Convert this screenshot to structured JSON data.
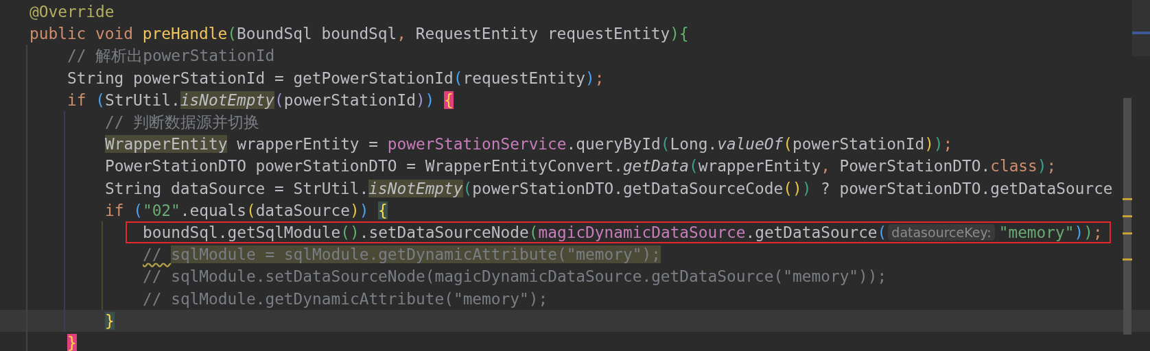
{
  "lines": [
    {
      "current": false,
      "boxed": false,
      "tokens": [
        {
          "kind": "annotation",
          "text": "@Override"
        }
      ]
    },
    {
      "current": false,
      "boxed": false,
      "tokens": [
        {
          "kind": "keyword",
          "text": "public void "
        },
        {
          "kind": "decl",
          "text": "preHandle"
        },
        {
          "kind": "paren-green",
          "text": "("
        },
        {
          "kind": "plain",
          "text": "BoundSql boundSql"
        },
        {
          "kind": "punct",
          "text": ", "
        },
        {
          "kind": "plain",
          "text": "RequestEntity requestEntity"
        },
        {
          "kind": "paren-green",
          "text": "){"
        }
      ],
      "children": [
        {
          "current": false,
          "boxed": false,
          "tokens": [
            {
              "kind": "comment",
              "text": "// 解析出powerStationId"
            }
          ]
        },
        {
          "current": false,
          "boxed": false,
          "tokens": [
            {
              "kind": "plain",
              "text": "String powerStationId = getPowerStationId"
            },
            {
              "kind": "paren-blue",
              "text": "("
            },
            {
              "kind": "plain",
              "text": "requestEntity"
            },
            {
              "kind": "paren-blue",
              "text": ")"
            },
            {
              "kind": "punct",
              "text": ";"
            }
          ]
        },
        {
          "current": false,
          "boxed": false,
          "tokens": [
            {
              "kind": "keyword",
              "text": "if "
            },
            {
              "kind": "paren-blue",
              "text": "("
            },
            {
              "kind": "plain",
              "text": "StrUtil."
            },
            {
              "kind": "static",
              "text": "isNotEmpty",
              "highlighted": true
            },
            {
              "kind": "paren-lavender",
              "text": "("
            },
            {
              "kind": "plain",
              "text": "powerStationId"
            },
            {
              "kind": "paren-lavender",
              "text": ")"
            },
            {
              "kind": "paren-blue",
              "text": ") "
            },
            {
              "kind": "brace",
              "text": "{",
              "matched": false
            }
          ],
          "children": [
            {
              "current": false,
              "boxed": false,
              "tokens": [
                {
                  "kind": "comment",
                  "text": "// 判断数据源并切换"
                }
              ]
            },
            {
              "current": false,
              "boxed": false,
              "tokens": [
                {
                  "kind": "plain",
                  "text": "WrapperEntity",
                  "highlighted": true
                },
                {
                  "kind": "plain",
                  "text": " wrapperEntity = "
                },
                {
                  "kind": "field",
                  "text": "powerStationService"
                },
                {
                  "kind": "plain",
                  "text": ".queryById"
                },
                {
                  "kind": "paren-teal",
                  "text": "("
                },
                {
                  "kind": "plain",
                  "text": "Long."
                },
                {
                  "kind": "static",
                  "text": "valueOf"
                },
                {
                  "kind": "paren-yellow",
                  "text": "("
                },
                {
                  "kind": "plain",
                  "text": "powerStationId"
                },
                {
                  "kind": "paren-yellow",
                  "text": ")"
                },
                {
                  "kind": "paren-teal",
                  "text": ")"
                },
                {
                  "kind": "punct",
                  "text": ";"
                }
              ]
            },
            {
              "current": false,
              "boxed": false,
              "tokens": [
                {
                  "kind": "plain",
                  "text": "PowerStationDTO powerStationDTO = WrapperEntityConvert."
                },
                {
                  "kind": "static",
                  "text": "getData"
                },
                {
                  "kind": "paren-teal",
                  "text": "("
                },
                {
                  "kind": "plain",
                  "text": "wrapperEntity"
                },
                {
                  "kind": "punct",
                  "text": ", "
                },
                {
                  "kind": "plain",
                  "text": "PowerStationDTO."
                },
                {
                  "kind": "keyword",
                  "text": "class"
                },
                {
                  "kind": "paren-teal",
                  "text": ")"
                },
                {
                  "kind": "punct",
                  "text": ";"
                }
              ]
            },
            {
              "current": false,
              "boxed": false,
              "tokens": [
                {
                  "kind": "plain",
                  "text": "String dataSource = StrUtil."
                },
                {
                  "kind": "static",
                  "text": "isNotEmpty",
                  "highlighted": true
                },
                {
                  "kind": "paren-teal",
                  "text": "("
                },
                {
                  "kind": "plain",
                  "text": "powerStationDTO.getDataSourceCode"
                },
                {
                  "kind": "paren-yellow",
                  "text": "()"
                },
                {
                  "kind": "paren-teal",
                  "text": ")"
                },
                {
                  "kind": "plain",
                  "text": " ? powerStationDTO.getDataSource"
                }
              ]
            },
            {
              "current": false,
              "boxed": false,
              "tokens": [
                {
                  "kind": "keyword",
                  "text": "if "
                },
                {
                  "kind": "paren-blue",
                  "text": "("
                },
                {
                  "kind": "string",
                  "text": "\"02\""
                },
                {
                  "kind": "plain",
                  "text": ".equals"
                },
                {
                  "kind": "paren-yellow",
                  "text": "("
                },
                {
                  "kind": "plain",
                  "text": "dataSource"
                },
                {
                  "kind": "paren-yellow",
                  "text": ")"
                },
                {
                  "kind": "paren-blue",
                  "text": ") "
                },
                {
                  "kind": "brace",
                  "text": "{",
                  "matched": true
                }
              ],
              "children": [
                {
                  "current": false,
                  "boxed": true,
                  "tokens": [
                    {
                      "kind": "plain",
                      "text": "boundSql.getSqlModule"
                    },
                    {
                      "kind": "paren-green",
                      "text": "()"
                    },
                    {
                      "kind": "plain",
                      "text": ".setDataSourceNode"
                    },
                    {
                      "kind": "paren-green",
                      "text": "("
                    },
                    {
                      "kind": "field",
                      "text": "magicDynamicDataSource"
                    },
                    {
                      "kind": "plain",
                      "text": ".getDataSource"
                    },
                    {
                      "kind": "paren-blue",
                      "text": "("
                    },
                    {
                      "kind": "hint",
                      "text": "datasourceKey:"
                    },
                    {
                      "kind": "string",
                      "text": "\"memory\""
                    },
                    {
                      "kind": "paren-blue",
                      "text": ")"
                    },
                    {
                      "kind": "paren-green",
                      "text": ")"
                    },
                    {
                      "kind": "punct",
                      "text": ";"
                    }
                  ]
                },
                {
                  "current": false,
                  "boxed": false,
                  "tokens": [
                    {
                      "kind": "comment",
                      "text": "// ",
                      "squiggle": true
                    },
                    {
                      "kind": "comment",
                      "text": "sqlModule = sqlModule.getDynamicAttribute(\"memory\");",
                      "highlighted": true
                    }
                  ]
                },
                {
                  "current": false,
                  "boxed": false,
                  "tokens": [
                    {
                      "kind": "comment",
                      "text": "// sqlModule.setDataSourceNode(magicDynamicDataSource.getDataSource(\"memory\"));"
                    }
                  ]
                },
                {
                  "current": false,
                  "boxed": false,
                  "tokens": [
                    {
                      "kind": "comment",
                      "text": "// sqlModule.getDynamicAttribute(\"memory\");"
                    }
                  ]
                }
              ]
            },
            {
              "current": true,
              "boxed": false,
              "tokens": [
                {
                  "kind": "brace",
                  "text": "}",
                  "matched": true
                }
              ]
            }
          ]
        },
        {
          "current": false,
          "boxed": false,
          "tokens": [
            {
              "kind": "brace",
              "text": "}",
              "matched": false
            }
          ]
        }
      ]
    }
  ]
}
